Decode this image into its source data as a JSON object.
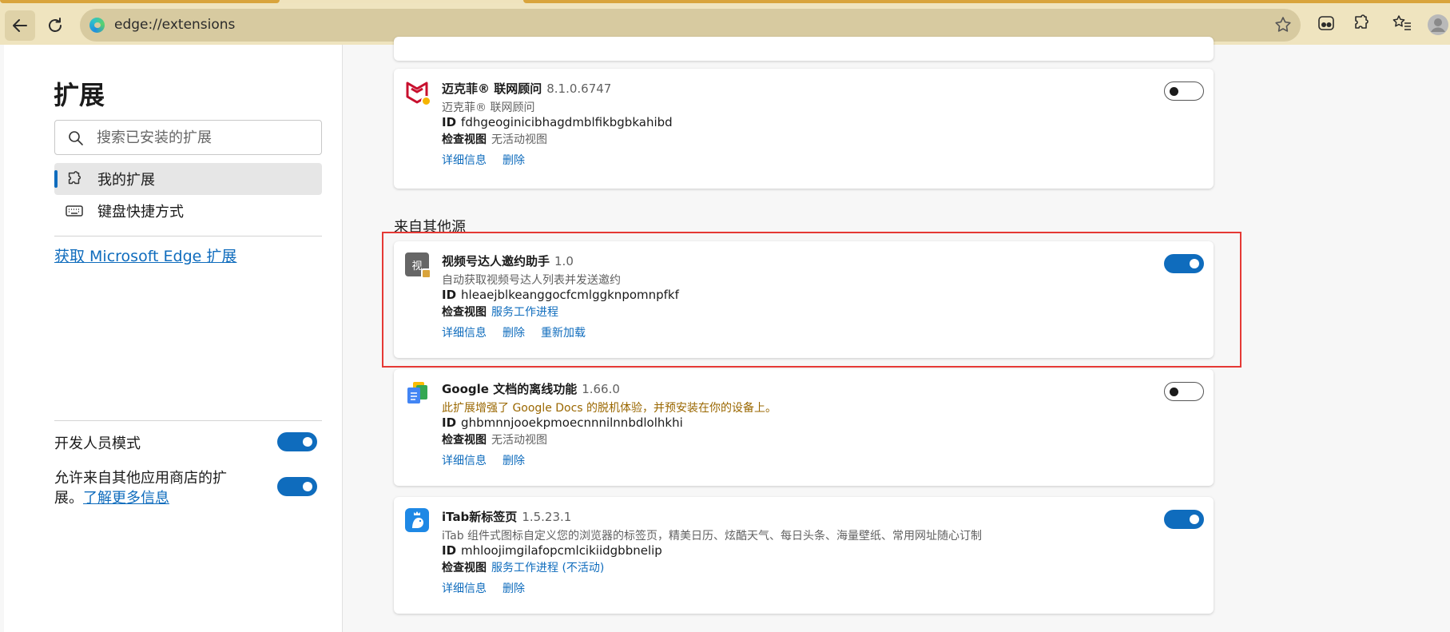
{
  "browser": {
    "url": "edge://extensions"
  },
  "sidebar": {
    "title": "扩展",
    "search_placeholder": "搜索已安装的扩展",
    "nav": [
      {
        "label": "我的扩展",
        "active": true
      },
      {
        "label": "键盘快捷方式",
        "active": false
      }
    ],
    "store_link": "获取 Microsoft Edge 扩展",
    "dev_mode_label": "开发人员模式",
    "dev_mode_on": true,
    "allow_other_label": "允许来自其他应用商店的扩展。",
    "allow_other_link": "了解更多信息",
    "allow_other_on": true
  },
  "main": {
    "section_other": "来自其他源",
    "cards": [
      {
        "name": "迈克菲® 联网顾问",
        "version": "8.1.0.6747",
        "description": "迈克菲® 联网顾问",
        "id_label": "ID",
        "id": "fdhgeoginicibhagdmblfikbgbkahibd",
        "inspect_label": "检查视图",
        "inspect_value": "无活动视图",
        "actions": [
          "详细信息",
          "删除"
        ],
        "enabled": false,
        "icon": "mcafee-shield-icon"
      },
      {
        "name": "视频号达人邀约助手",
        "version": "1.0",
        "description": "自动获取视频号达人列表并发送邀约",
        "id_label": "ID",
        "id": "hleaejblkeanggocfcmlggknpomnpfkf",
        "inspect_label": "检查视图",
        "inspect_value": "服务工作进程",
        "actions": [
          "详细信息",
          "删除",
          "重新加载"
        ],
        "enabled": true,
        "icon_char": "视"
      },
      {
        "name": "Google 文档的离线功能",
        "version": "1.66.0",
        "description": "此扩展增强了 Google Docs 的脱机体验，并预安装在你的设备上。",
        "id_label": "ID",
        "id": "ghbmnnjooekpmoecnnnilnnbdlolhkhi",
        "inspect_label": "检查视图",
        "inspect_value": "无活动视图",
        "actions": [
          "详细信息",
          "删除"
        ],
        "enabled": false,
        "icon": "google-docs-icon"
      },
      {
        "name": "iTab新标签页",
        "version": "1.5.23.1",
        "description": "iTab 组件式图标自定义您的浏览器的标签页，精美日历、炫酷天气、每日头条、海量壁纸、常用网址随心订制",
        "id_label": "ID",
        "id": "mhloojimgilafopcmlcikiidgbbnelip",
        "inspect_label": "检查视图",
        "inspect_value": "服务工作进程 (不活动)",
        "actions": [
          "详细信息",
          "删除"
        ],
        "enabled": true,
        "icon": "itab-bird-icon"
      }
    ]
  },
  "colors": {
    "accent": "#0f6cbd",
    "highlight": "#e53935",
    "warning": "#9a6700"
  }
}
